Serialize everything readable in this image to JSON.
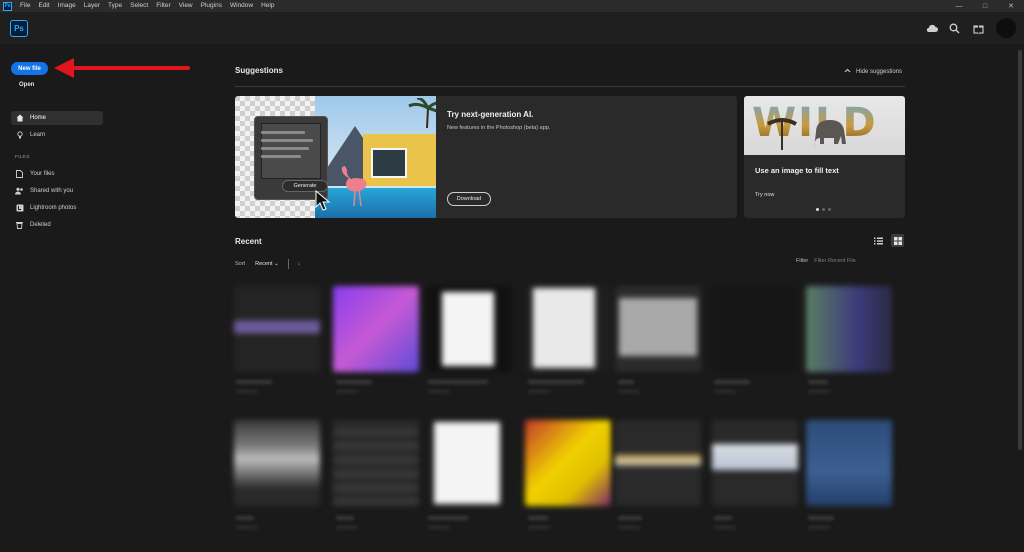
{
  "menu": {
    "app_badge": "Ps",
    "items": [
      "File",
      "Edit",
      "Image",
      "Layer",
      "Type",
      "Select",
      "Filter",
      "View",
      "Plugins",
      "Window",
      "Help"
    ],
    "window_controls": [
      "—",
      "□",
      "✕"
    ]
  },
  "header": {
    "logo": "Ps",
    "icons": [
      "cloud-icon",
      "search-icon",
      "gift-icon"
    ]
  },
  "sidebar": {
    "new_file": "New file",
    "open": "Open",
    "nav": [
      {
        "label": "Home",
        "icon": "home-icon",
        "active": true
      },
      {
        "label": "Learn",
        "icon": "lightbulb-icon",
        "active": false
      }
    ],
    "files_label": "FILES",
    "files": [
      {
        "label": "Your files",
        "icon": "document-icon"
      },
      {
        "label": "Shared with you",
        "icon": "people-icon"
      },
      {
        "label": "Lightroom photos",
        "icon": "lightroom-icon"
      },
      {
        "label": "Deleted",
        "icon": "trash-icon"
      }
    ]
  },
  "suggestions": {
    "title": "Suggestions",
    "hide": "Hide suggestions",
    "big_card": {
      "title": "Try next-generation AI.",
      "subtitle": "New features in the Photoshop (beta) app.",
      "button": "Download",
      "generate": "Generate"
    },
    "small_card": {
      "image_word": "WILD",
      "title": "Use an image to fill text",
      "link": "Try now"
    }
  },
  "recent": {
    "title": "Recent",
    "sort_label": "Sort",
    "sort_value": "Recent",
    "filter_label": "Filter",
    "filter_placeholder": "Filter Recent File"
  },
  "accent": "#1473e6",
  "annotation_color": "#e0161c"
}
